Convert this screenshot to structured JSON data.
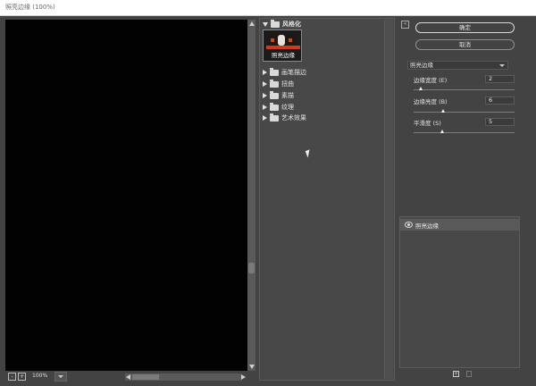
{
  "window": {
    "title": "照亮边缘 (100%)"
  },
  "preview": {
    "zoom": "100%",
    "zoom_out_label": "-",
    "zoom_in_label": "+"
  },
  "filter_tree": {
    "open_category": "风格化",
    "selected_filter": "照亮边缘",
    "categories": [
      "画笔描边",
      "扭曲",
      "素描",
      "纹理",
      "艺术效果"
    ]
  },
  "dialog": {
    "ok_label": "确定",
    "cancel_label": "取消",
    "collapse_label": "«",
    "filter_select": "照亮边缘",
    "params": [
      {
        "label": "边缘宽度 (E)",
        "value": "2",
        "level": 0.14
      },
      {
        "label": "边缘亮度 (B)",
        "value": "6",
        "level": 0.3
      },
      {
        "label": "平滑度 (S)",
        "value": "5",
        "level": 0.33
      }
    ]
  },
  "effect_layers": {
    "items": [
      {
        "label": "照亮边缘",
        "visible": true
      }
    ],
    "new_layer_label": "+"
  }
}
